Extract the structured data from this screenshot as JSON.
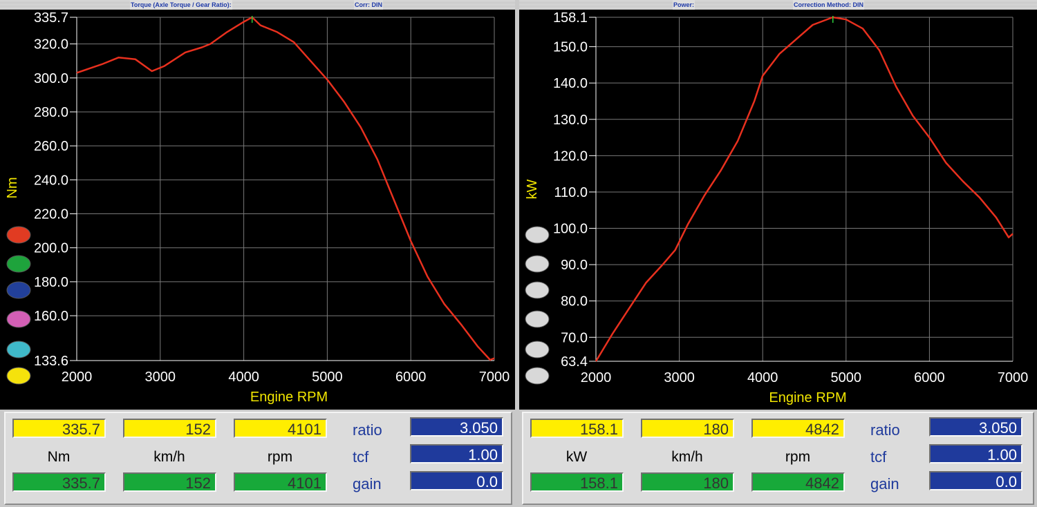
{
  "left": {
    "header": {
      "title": "Torque (Axle Torque / Gear Ratio):",
      "corr": "Corr: DIN"
    },
    "chart_data": {
      "type": "line",
      "xlabel": "Engine RPM",
      "ylabel": "Nm",
      "xlim": [
        2000,
        7000
      ],
      "ylim": [
        133.6,
        335.7
      ],
      "x_ticks": [
        "2000",
        "3000",
        "4000",
        "5000",
        "6000",
        "7000"
      ],
      "y_ticks": [
        "335.7",
        "320.0",
        "300.0",
        "280.0",
        "260.0",
        "240.0",
        "220.0",
        "200.0",
        "180.0",
        "160.0",
        "133.6"
      ],
      "y_tick_values": [
        335.7,
        320,
        300,
        280,
        260,
        240,
        220,
        200,
        180,
        160,
        133.6
      ],
      "grid": true,
      "series": [
        {
          "color": "#e8301e",
          "x": [
            2000,
            2300,
            2500,
            2700,
            2900,
            3050,
            3300,
            3500,
            3600,
            3800,
            4000,
            4100,
            4200,
            4400,
            4600,
            4800,
            5000,
            5200,
            5400,
            5600,
            5800,
            6000,
            6200,
            6400,
            6600,
            6800,
            6950,
            7000
          ],
          "y": [
            303,
            308,
            312,
            311,
            304,
            307,
            315,
            318,
            320,
            327,
            333,
            335.7,
            331,
            327,
            321,
            310,
            299,
            286,
            271,
            252,
            228,
            204,
            183,
            167,
            155,
            142,
            134,
            135
          ]
        }
      ],
      "legend_dots": [
        "#e13b22",
        "#1ea33c",
        "#22409a",
        "#d35fb5",
        "#3fb9c9",
        "#f5e20c"
      ]
    },
    "readout": {
      "value": "335.7",
      "speed": "152",
      "rpm": "4101",
      "unit": "Nm",
      "speed_unit": "km/h",
      "rpm_unit": "rpm",
      "value2": "335.7",
      "speed2": "152",
      "rpm2": "4101",
      "ratio_label": "ratio",
      "ratio": "3.050",
      "tcf_label": "tcf",
      "tcf": "1.00",
      "gain_label": "gain",
      "gain": "0.0"
    }
  },
  "right": {
    "header": {
      "title": "Power:",
      "corr": "Correction Method: DIN"
    },
    "chart_data": {
      "type": "line",
      "xlabel": "Engine RPM",
      "ylabel": "kW",
      "xlim": [
        2000,
        7000
      ],
      "ylim": [
        63.4,
        158.1
      ],
      "x_ticks": [
        "2000",
        "3000",
        "4000",
        "5000",
        "6000",
        "7000"
      ],
      "y_ticks": [
        "158.1",
        "150.0",
        "140.0",
        "130.0",
        "120.0",
        "110.0",
        "100.0",
        "90.0",
        "80.0",
        "70.0",
        "63.4"
      ],
      "y_tick_values": [
        158.1,
        150,
        140,
        130,
        120,
        110,
        100,
        90,
        80,
        70,
        63.4
      ],
      "grid": true,
      "series": [
        {
          "color": "#e8301e",
          "x": [
            2000,
            2200,
            2400,
            2600,
            2800,
            2950,
            3100,
            3300,
            3500,
            3700,
            3900,
            4000,
            4200,
            4400,
            4600,
            4842,
            5000,
            5200,
            5400,
            5600,
            5800,
            6000,
            6200,
            6400,
            6600,
            6800,
            6950,
            7000
          ],
          "y": [
            63.4,
            71,
            78,
            85,
            90,
            94,
            101,
            109,
            116,
            124,
            135,
            142,
            148,
            152,
            156,
            158.1,
            157.5,
            155,
            149,
            139,
            131,
            125,
            118,
            113,
            108.5,
            103,
            97.5,
            98.5
          ]
        }
      ],
      "legend_dots": [
        "#d8d8d8",
        "#d8d8d8",
        "#d8d8d8",
        "#d8d8d8",
        "#d8d8d8",
        "#d8d8d8"
      ]
    },
    "readout": {
      "value": "158.1",
      "speed": "180",
      "rpm": "4842",
      "unit": "kW",
      "speed_unit": "km/h",
      "rpm_unit": "rpm",
      "value2": "158.1",
      "speed2": "180",
      "rpm2": "4842",
      "ratio_label": "ratio",
      "ratio": "3.050",
      "tcf_label": "tcf",
      "tcf": "1.00",
      "gain_label": "gain",
      "gain": "0.0"
    }
  }
}
